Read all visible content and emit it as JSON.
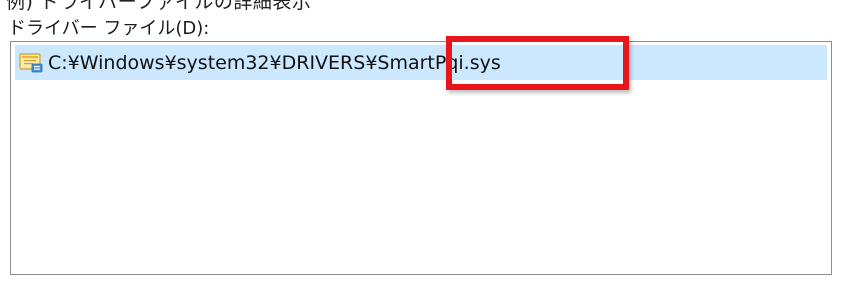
{
  "page": {
    "clipped_title": "例) ドライバーファイルの詳細表示"
  },
  "driver_files": {
    "label": "ドライバー ファイル(D):",
    "items": [
      {
        "icon": "driver-file-icon",
        "path": "C:¥Windows¥system32¥DRIVERS¥SmartPqi.sys",
        "selected": true
      }
    ]
  },
  "colors": {
    "selection_background": "#cce8ff",
    "highlight_box": "#e8151b",
    "listbox_border": "#8e8e8e"
  }
}
